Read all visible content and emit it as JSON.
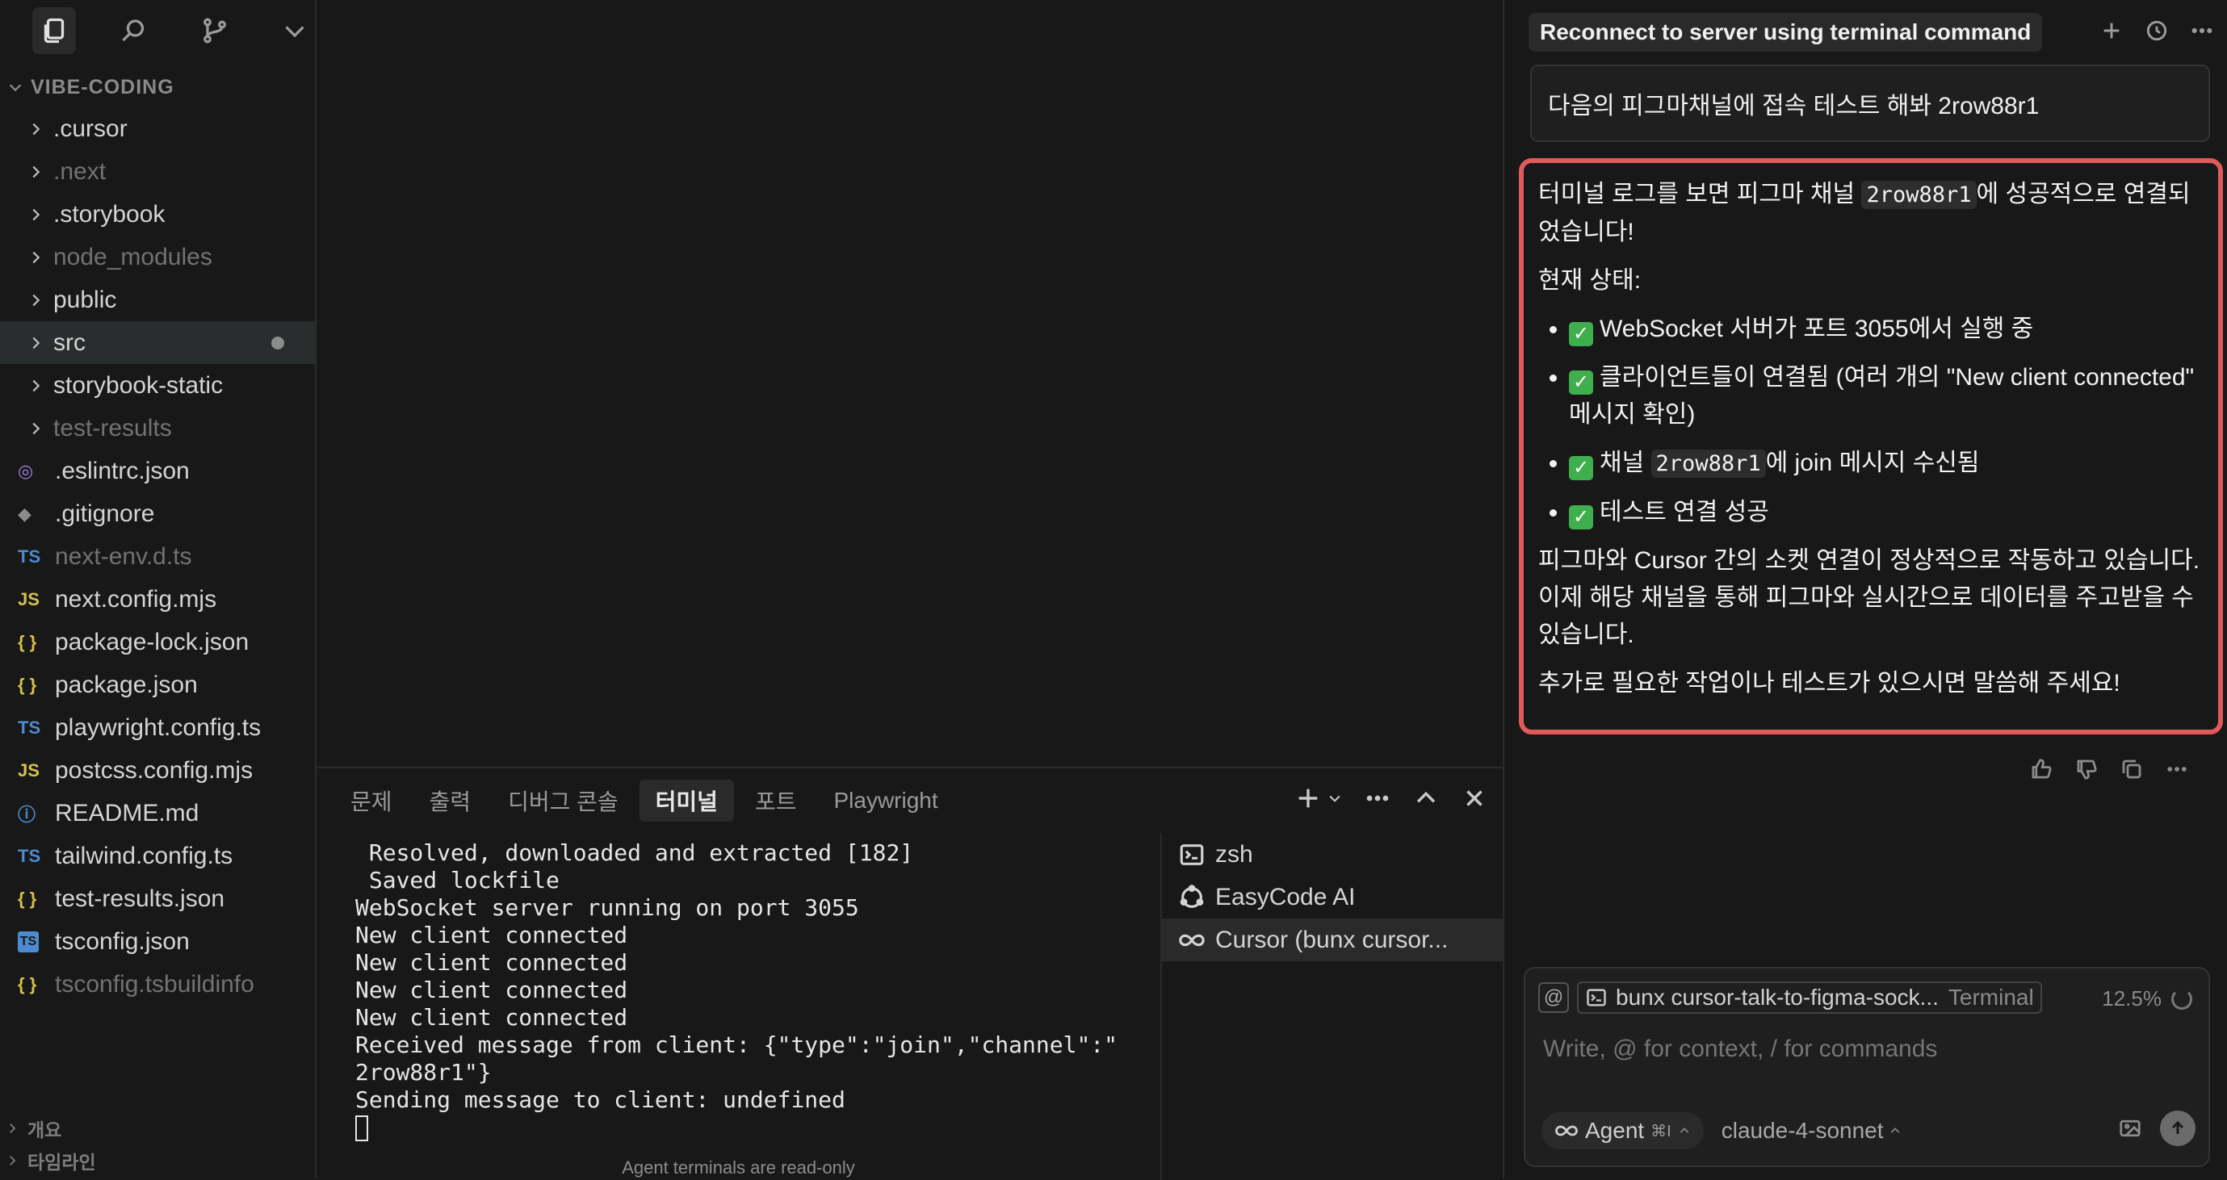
{
  "sidebar": {
    "project_name": "VIBE-CODING",
    "tree": [
      {
        "type": "folder",
        "label": ".cursor",
        "dim": false
      },
      {
        "type": "folder",
        "label": ".next",
        "dim": true
      },
      {
        "type": "folder",
        "label": ".storybook",
        "dim": false
      },
      {
        "type": "folder",
        "label": "node_modules",
        "dim": true
      },
      {
        "type": "folder",
        "label": "public",
        "dim": false
      },
      {
        "type": "folder",
        "label": "src",
        "dim": false,
        "selected": true,
        "modified": true
      },
      {
        "type": "folder",
        "label": "storybook-static",
        "dim": false
      },
      {
        "type": "folder",
        "label": "test-results",
        "dim": true
      },
      {
        "type": "file",
        "icon": "eslint",
        "label": ".eslintrc.json",
        "dim": false
      },
      {
        "type": "file",
        "icon": "git",
        "label": ".gitignore",
        "dim": false
      },
      {
        "type": "file",
        "icon": "ts",
        "label": "next-env.d.ts",
        "dim": true
      },
      {
        "type": "file",
        "icon": "js",
        "label": "next.config.mjs",
        "dim": false
      },
      {
        "type": "file",
        "icon": "json",
        "label": "package-lock.json",
        "dim": false
      },
      {
        "type": "file",
        "icon": "json",
        "label": "package.json",
        "dim": false
      },
      {
        "type": "file",
        "icon": "ts",
        "label": "playwright.config.ts",
        "dim": false
      },
      {
        "type": "file",
        "icon": "js",
        "label": "postcss.config.mjs",
        "dim": false
      },
      {
        "type": "file",
        "icon": "info",
        "label": "README.md",
        "dim": false
      },
      {
        "type": "file",
        "icon": "ts",
        "label": "tailwind.config.ts",
        "dim": false
      },
      {
        "type": "file",
        "icon": "json",
        "label": "test-results.json",
        "dim": false
      },
      {
        "type": "file",
        "icon": "tsconfig",
        "label": "tsconfig.json",
        "dim": false
      },
      {
        "type": "file",
        "icon": "json",
        "label": "tsconfig.tsbuildinfo",
        "dim": true
      }
    ],
    "sections": [
      "개요",
      "타임라인"
    ]
  },
  "panel": {
    "tabs": [
      "문제",
      "출력",
      "디버그 콘솔",
      "터미널",
      "포트",
      "Playwright"
    ],
    "active_tab": "터미널",
    "terminal_lines": [
      " Resolved, downloaded and extracted [182]",
      " Saved lockfile",
      "WebSocket server running on port 3055",
      "New client connected",
      "New client connected",
      "New client connected",
      "New client connected",
      "Received message from client: {\"type\":\"join\",\"channel\":\"",
      "2row88r1\"}",
      "Sending message to client: undefined"
    ],
    "readonly_note": "Agent terminals are read-only",
    "terminals": [
      {
        "icon": "terminal-icon",
        "label": "zsh"
      },
      {
        "icon": "easycode-icon",
        "label": "EasyCode AI"
      },
      {
        "icon": "infinity-icon",
        "label": "Cursor (bunx cursor..."
      }
    ]
  },
  "chat": {
    "title": "Reconnect to server using terminal command",
    "user_message": "다음의 피그마채널에 접속 테스트 해봐 2row88r1",
    "assistant": {
      "p1_before": "터미널 로그를 보면 피그마 채널 ",
      "channel": "2row88r1",
      "p1_after": "에 성공적으로 연결되었습니다!",
      "status_heading": "현재 상태:",
      "bullet1": "WebSocket 서버가 포트 3055에서 실행 중",
      "bullet2": "클라이언트들이 연결됨 (여러 개의 \"New client connected\" 메시지 확인)",
      "bullet3_before": "채널 ",
      "bullet3_after": "에 join 메시지 수신됨",
      "bullet4": "테스트 연결 성공",
      "p2": "피그마와 Cursor 간의 소켓 연결이 정상적으로 작동하고 있습니다. 이제 해당 채널을 통해 피그마와 실시간으로 데이터를 주고받을 수 있습니다.",
      "p3": "추가로 필요한 작업이나 테스트가 있으시면 말씀해 주세요!",
      "check": "✓"
    },
    "composer": {
      "at": "@",
      "context_chip": "bunx cursor-talk-to-figma-sock...",
      "context_kind": "Terminal",
      "context_pct": "12.5%",
      "placeholder": "Write, @ for context, / for commands",
      "agent_label": "Agent",
      "agent_kbd": "⌘I",
      "model": "claude-4-sonnet"
    }
  },
  "colors": {
    "highlight_border": "#e05a5a",
    "check_green": "#3fae4c",
    "ts_blue": "#4d8bd1",
    "js_yellow": "#d6c24b"
  }
}
